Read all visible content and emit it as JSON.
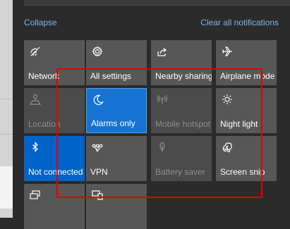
{
  "header": {
    "collapse_label": "Collapse",
    "clear_all_label": "Clear all notifications"
  },
  "tiles": [
    {
      "label": "Network",
      "icon": "network-icon",
      "state": "normal"
    },
    {
      "label": "All settings",
      "icon": "gear-icon",
      "state": "normal"
    },
    {
      "label": "Nearby sharing",
      "icon": "share-icon",
      "state": "normal"
    },
    {
      "label": "Airplane mode",
      "icon": "airplane-icon",
      "state": "normal"
    },
    {
      "label": "Location",
      "icon": "location-icon",
      "state": "disabled"
    },
    {
      "label": "Alarms only",
      "icon": "moon-icon",
      "state": "active"
    },
    {
      "label": "Mobile hotspot",
      "icon": "hotspot-icon",
      "state": "disabled"
    },
    {
      "label": "Night light",
      "icon": "sun-icon",
      "state": "normal"
    },
    {
      "label": "Not connected",
      "icon": "bluetooth-icon",
      "state": "active"
    },
    {
      "label": "VPN",
      "icon": "vpn-icon",
      "state": "normal"
    },
    {
      "label": "Battery saver",
      "icon": "leaf-icon",
      "state": "disabled"
    },
    {
      "label": "Screen snip",
      "icon": "snip-icon",
      "state": "normal"
    },
    {
      "label": "",
      "icon": "project-icon",
      "state": "normal"
    },
    {
      "label": "",
      "icon": "connect-icon",
      "state": "normal"
    }
  ],
  "colors": {
    "accent": "#0063c7",
    "tile": "#575757",
    "link": "#7fb5ea",
    "highlight": "#e50000"
  }
}
